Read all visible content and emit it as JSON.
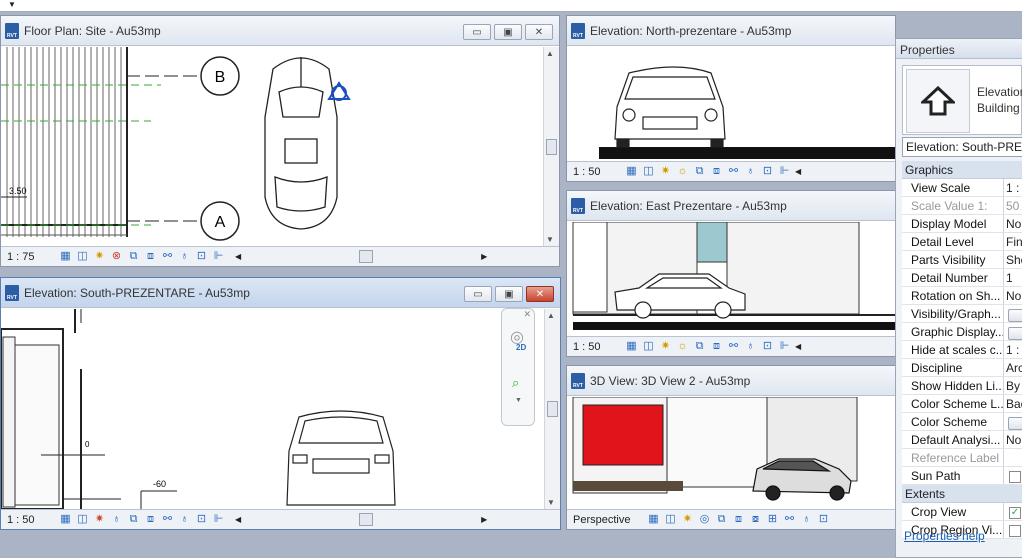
{
  "windows": {
    "floor": {
      "title": "Floor Plan: Site - Au53mp",
      "scale": "1 : 75",
      "grid_a": "A",
      "grid_b": "B",
      "dim": "3.50"
    },
    "north": {
      "title": "Elevation: North-prezentare - Au53mp",
      "scale": "1 : 50"
    },
    "east": {
      "title": "Elevation: East Prezentare - Au53mp",
      "scale": "1 : 50"
    },
    "south": {
      "title": "Elevation: South-PREZENTARE - Au53mp",
      "scale": "1 : 50",
      "level_label": "-60",
      "level0": "0",
      "nav_2d": "2D"
    },
    "view3d": {
      "title": "3D View: 3D View 2 - Au53mp",
      "scale": "Perspective"
    }
  },
  "window_buttons": {
    "minimize": "▭",
    "restore": "▣",
    "close": "✕"
  },
  "properties": {
    "title": "Properties",
    "type_line1": "Elevation",
    "type_line2": "Building",
    "dropdown": "Elevation: South-PREZ",
    "section_graphics": "Graphics",
    "rows": [
      {
        "name": "View Scale",
        "value": "1 :",
        "disabled": false,
        "kind": "text"
      },
      {
        "name": "Scale Value 1:",
        "value": "50",
        "disabled": true,
        "kind": "text"
      },
      {
        "name": "Display Model",
        "value": "No",
        "disabled": false,
        "kind": "text"
      },
      {
        "name": "Detail Level",
        "value": "Fin",
        "disabled": false,
        "kind": "text"
      },
      {
        "name": "Parts Visibility",
        "value": "Sho",
        "disabled": false,
        "kind": "text"
      },
      {
        "name": "Detail Number",
        "value": "1",
        "disabled": false,
        "kind": "text"
      },
      {
        "name": "Rotation on Sh...",
        "value": "No",
        "disabled": false,
        "kind": "text"
      },
      {
        "name": "Visibility/Graph...",
        "value": "",
        "disabled": false,
        "kind": "button"
      },
      {
        "name": "Graphic Display...",
        "value": "",
        "disabled": false,
        "kind": "button"
      },
      {
        "name": "Hide at scales c...",
        "value": "1 :",
        "disabled": false,
        "kind": "text"
      },
      {
        "name": "Discipline",
        "value": "Arc",
        "disabled": false,
        "kind": "text"
      },
      {
        "name": "Show Hidden Li...",
        "value": "By",
        "disabled": false,
        "kind": "text"
      },
      {
        "name": "Color Scheme L...",
        "value": "Bac",
        "disabled": false,
        "kind": "text"
      },
      {
        "name": "Color Scheme",
        "value": "",
        "disabled": false,
        "kind": "button"
      },
      {
        "name": "Default Analysi...",
        "value": "No",
        "disabled": false,
        "kind": "text"
      },
      {
        "name": "Reference Label",
        "value": "",
        "disabled": true,
        "kind": "text"
      },
      {
        "name": "Sun Path",
        "value": "",
        "disabled": false,
        "kind": "check"
      }
    ],
    "section_extents": "Extents",
    "extent_rows": [
      {
        "name": "Crop View",
        "value": "✓",
        "kind": "check"
      },
      {
        "name": "Crop Region Vi...",
        "value": "",
        "kind": "check"
      }
    ],
    "help": "Properties help"
  },
  "colors": {
    "accent": "#2b5ea5",
    "frame": "#aab4c4",
    "red_wall": "#e0141a"
  }
}
